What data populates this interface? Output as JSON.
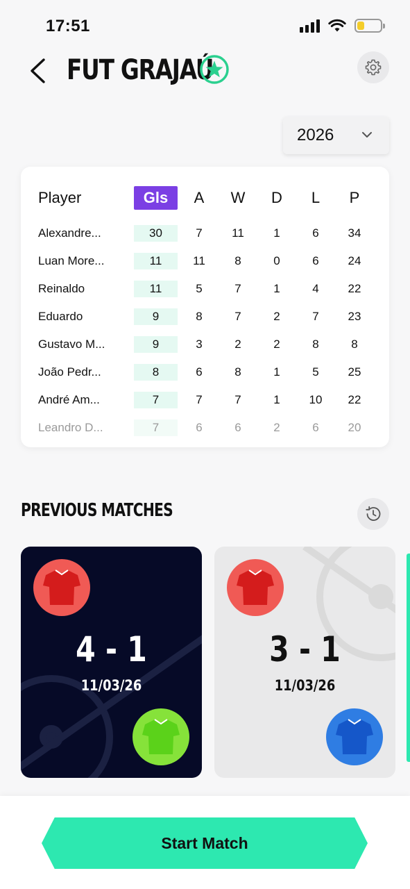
{
  "status_bar": {
    "time": "17:51",
    "battery_level": 0.3
  },
  "header": {
    "title": "FUT GRAJAÚ",
    "back_icon": "chevron-left-icon",
    "favorite_icon": "star-icon",
    "settings_icon": "gear-icon"
  },
  "colors": {
    "accent": "#2de8b0",
    "gls_header": "#7b3fe4",
    "dark_card": "#060a27",
    "star_badge": "#2bd08f"
  },
  "year_select": {
    "value": "2026"
  },
  "stats": {
    "headers": {
      "player": "Player",
      "gls": "Gls",
      "a": "A",
      "w": "W",
      "d": "D",
      "l": "L",
      "p": "P"
    },
    "rows": [
      {
        "player": "Alexandre...",
        "gls": "30",
        "a": "7",
        "w": "11",
        "d": "1",
        "l": "6",
        "p": "34"
      },
      {
        "player": "Luan More...",
        "gls": "11",
        "a": "11",
        "w": "8",
        "d": "0",
        "l": "6",
        "p": "24"
      },
      {
        "player": "Reinaldo",
        "gls": "11",
        "a": "5",
        "w": "7",
        "d": "1",
        "l": "4",
        "p": "22"
      },
      {
        "player": "Eduardo",
        "gls": "9",
        "a": "8",
        "w": "7",
        "d": "2",
        "l": "7",
        "p": "23"
      },
      {
        "player": "Gustavo M...",
        "gls": "9",
        "a": "3",
        "w": "2",
        "d": "2",
        "l": "8",
        "p": "8"
      },
      {
        "player": "João Pedr...",
        "gls": "8",
        "a": "6",
        "w": "8",
        "d": "1",
        "l": "5",
        "p": "25"
      },
      {
        "player": "André Am...",
        "gls": "7",
        "a": "7",
        "w": "7",
        "d": "1",
        "l": "10",
        "p": "22"
      },
      {
        "player": "Leandro D...",
        "gls": "7",
        "a": "6",
        "w": "6",
        "d": "2",
        "l": "6",
        "p": "20"
      }
    ]
  },
  "previous_matches": {
    "title": "PREVIOUS MATCHES",
    "history_icon": "history-icon",
    "matches": [
      {
        "score": "4 - 1",
        "date": "11/03/26",
        "home_color": "#f05a55",
        "away_color": "#86e23a"
      },
      {
        "score": "3 - 1",
        "date": "11/03/26",
        "home_color": "#f05a55",
        "away_color": "#2f7de3"
      }
    ]
  },
  "start_button": {
    "label": "Start Match"
  }
}
